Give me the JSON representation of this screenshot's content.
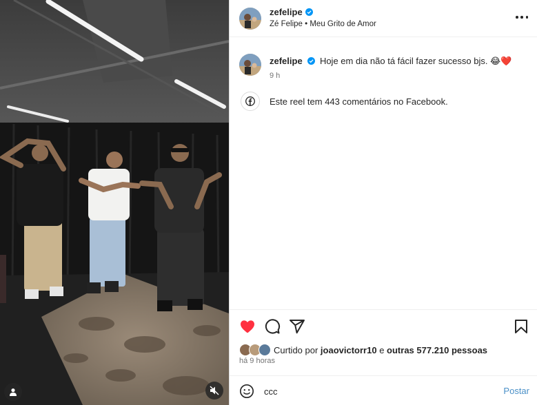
{
  "post": {
    "username": "zefelipe",
    "audio": "Zé Felipe • Meu Grito de Amor",
    "caption_user": "zefelipe",
    "caption_text": "Hoje em dia não tá fácil fazer sucesso bjs. 😂❤️",
    "caption_time": "9 h",
    "facebook_note": "Este reel tem 443 comentários no Facebook.",
    "likes_prefix": "Curtido por ",
    "likes_user": "joaovictorr10",
    "likes_middle": " e ",
    "likes_count": "outras 577.210 pessoas",
    "post_time": "há 9 horas"
  },
  "comment": {
    "value": "ccc",
    "post_label": "Postar"
  },
  "colors": {
    "like_red": "#ff3040",
    "verified_blue": "#0095f6",
    "link_blue": "#4a90c8"
  },
  "icons": [
    "more-icon",
    "verified-icon",
    "facebook-icon",
    "heart-icon",
    "comment-icon",
    "share-icon",
    "save-icon",
    "emoji-icon",
    "user-tag-icon",
    "mute-icon"
  ]
}
